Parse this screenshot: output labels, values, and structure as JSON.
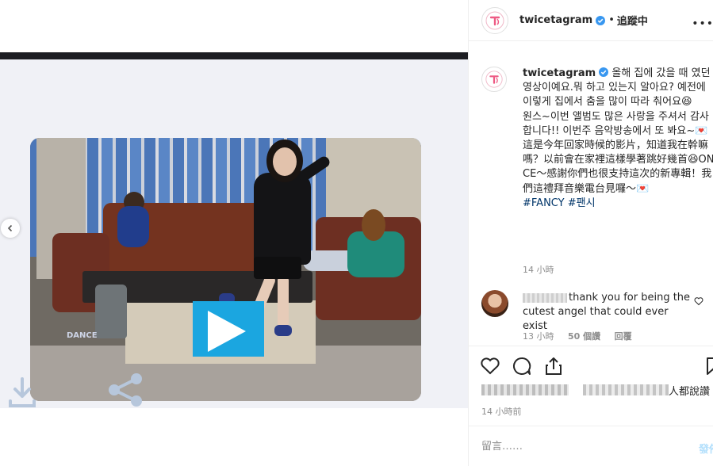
{
  "post": {
    "username": "twicetagram",
    "follow_label": "追蹤中",
    "separator": "•",
    "more_label": "•••"
  },
  "media": {
    "watermark": "DANCE"
  },
  "caption": {
    "username": "twicetagram",
    "text": "올해 집에 갔을 때 였던 영상이예요.뭐 하고 있는지 알아요? 예전에 이렇게 집에서 춤을 많이 따라 춰어요😆\n원스~이번 앨범도 많은 사랑을 주셔서 감사합니다!! 이번주 음악방송에서 또 봐요~💌\n這是今年回家時候的影片，知道我在幹嘛嗎？以前會在家裡這樣學著跳好幾首😆ONCE～感謝你們也很支持這次的新專輯！我們這禮拜音樂電台見囉～💌",
    "hashtags": "#FANCY #팬시",
    "time": "14 小時"
  },
  "comment": {
    "text": "thank you for being the cutest angel that could ever exist",
    "time": "13 小時",
    "likes": "50 個讚",
    "reply": "回覆"
  },
  "actions": {
    "likes_tail": "人都說讚",
    "post_time": "14 小時前",
    "comment_placeholder": "留言……",
    "post_button": "發佈"
  },
  "colors": {
    "accent": "#0095f6",
    "hashtag": "#003569",
    "muted": "#8e8e8e",
    "play_button": "#1ba6e0"
  }
}
